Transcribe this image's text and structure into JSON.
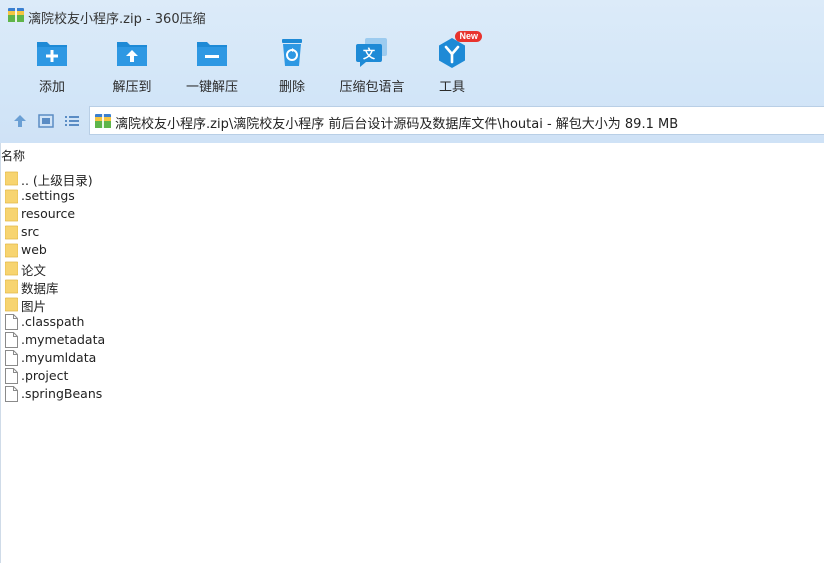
{
  "window": {
    "title": "漓院校友小程序.zip - 360压缩"
  },
  "toolbar": {
    "items": [
      {
        "label": "添加",
        "icon": "add-folder-icon"
      },
      {
        "label": "解压到",
        "icon": "extract-to-icon"
      },
      {
        "label": "一键解压",
        "icon": "one-click-extract-icon"
      },
      {
        "label": "删除",
        "icon": "delete-bin-icon"
      },
      {
        "label": "压缩包语言",
        "icon": "language-icon"
      },
      {
        "label": "工具",
        "icon": "tools-icon",
        "badge": "New"
      }
    ]
  },
  "navbar": {
    "path": "漓院校友小程序.zip\\漓院校友小程序 前后台设计源码及数据库文件\\houtai - 解包大小为 89.1 MB"
  },
  "list": {
    "header_name": "名称",
    "items": [
      {
        "name": ".. (上级目录)",
        "type": "folder"
      },
      {
        "name": ".settings",
        "type": "folder"
      },
      {
        "name": "resource",
        "type": "folder"
      },
      {
        "name": "src",
        "type": "folder"
      },
      {
        "name": "web",
        "type": "folder"
      },
      {
        "name": "论文",
        "type": "folder"
      },
      {
        "name": "数据库",
        "type": "folder"
      },
      {
        "name": "图片",
        "type": "folder"
      },
      {
        "name": ".classpath",
        "type": "file"
      },
      {
        "name": ".mymetadata",
        "type": "file"
      },
      {
        "name": ".myumldata",
        "type": "file"
      },
      {
        "name": ".project",
        "type": "file"
      },
      {
        "name": ".springBeans",
        "type": "file"
      }
    ]
  },
  "colors": {
    "accent": "#1e8ad6",
    "folder": "#f7d470",
    "badge": "#e8342e"
  }
}
